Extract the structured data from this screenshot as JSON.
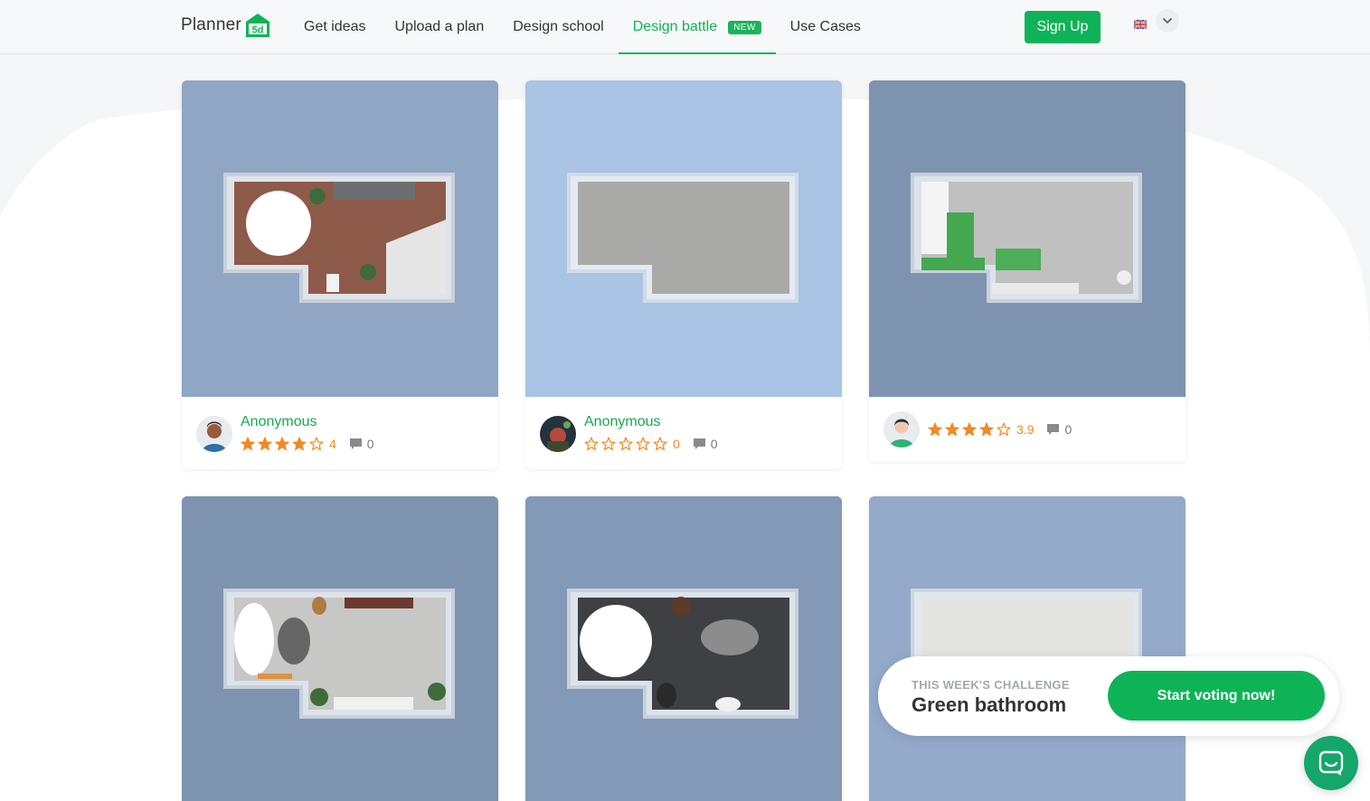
{
  "header": {
    "logo_text": "Planner",
    "logo_mark": "5d",
    "nav": [
      {
        "label": "Get ideas",
        "active": false
      },
      {
        "label": "Upload a plan",
        "active": false
      },
      {
        "label": "Design school",
        "active": false
      },
      {
        "label": "Design battle",
        "active": true,
        "badge": "NEW"
      },
      {
        "label": "Use Cases",
        "active": false
      }
    ],
    "signup_label": "Sign Up",
    "language_flag": "uk-flag-icon"
  },
  "cards": [
    {
      "author": "Anonymous",
      "rating": 4,
      "rating_label": "4",
      "comments": "0",
      "thumb_bg": "#8fa6c4"
    },
    {
      "author": "Anonymous",
      "rating": 0,
      "rating_label": "0",
      "comments": "0",
      "thumb_bg": "#a9c4e4"
    },
    {
      "author": "",
      "rating": 3.9,
      "rating_label": "3.9",
      "comments": "0",
      "thumb_bg": "#7d93b0"
    },
    {
      "author": "",
      "rating": null,
      "rating_label": "",
      "comments": "",
      "thumb_bg": "#7d93b0"
    },
    {
      "author": "",
      "rating": null,
      "rating_label": "",
      "comments": "",
      "thumb_bg": "#8299b7"
    },
    {
      "author": "",
      "rating": null,
      "rating_label": "",
      "comments": "",
      "thumb_bg": "#93aacb"
    }
  ],
  "challenge": {
    "label": "THIS WEEK'S CHALLENGE",
    "title": "Green bathroom",
    "button_label": "Start voting now!"
  },
  "colors": {
    "accent": "#0fb357",
    "star": "#f08a24",
    "chat": "#14a66a"
  }
}
